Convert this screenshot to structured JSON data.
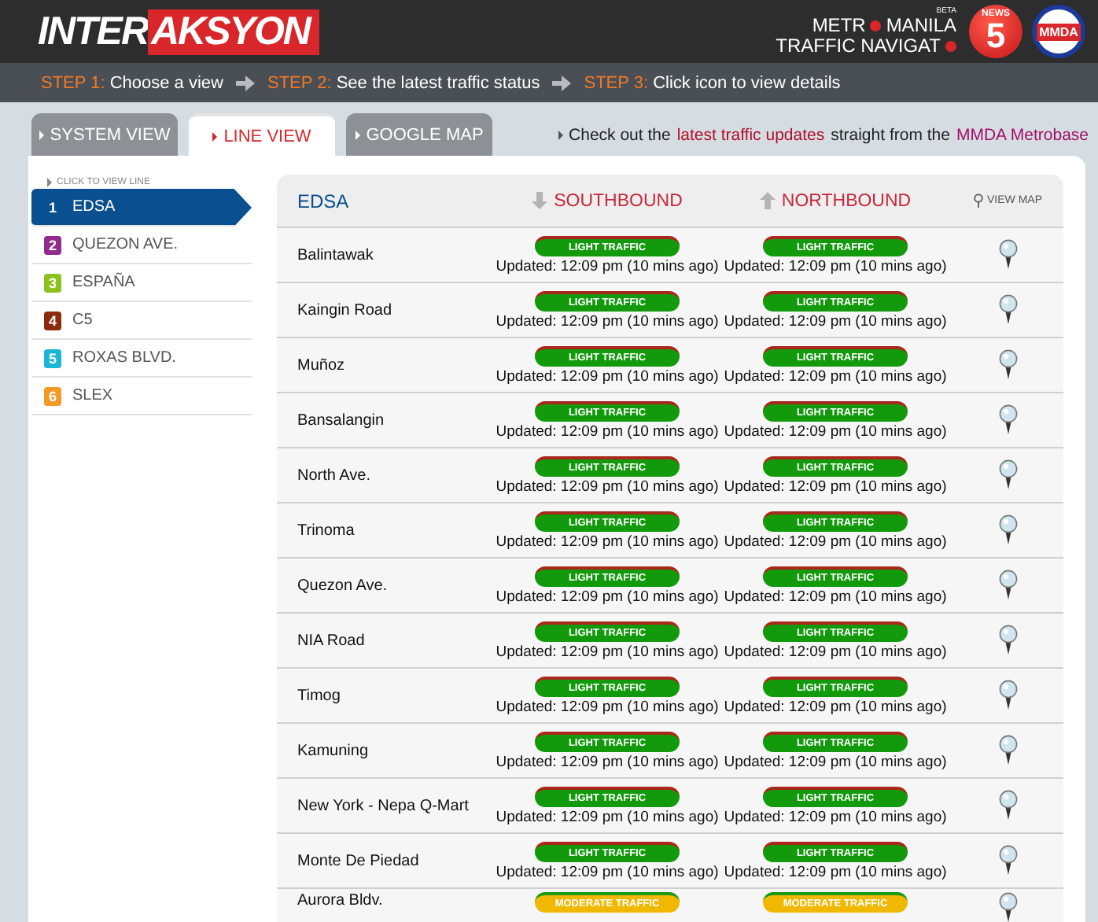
{
  "header": {
    "logo": {
      "part_1": "INTER",
      "part_2": "AKSYON"
    },
    "navigator": {
      "line_1a": "METR",
      "line_1b": "MANILA",
      "badge": "BETA",
      "line_2": "TRAFFIC NAVIGAT"
    },
    "news_logo": {
      "top": "NEWS",
      "number": "5"
    },
    "mmda_logo": {
      "text": "MMDA"
    }
  },
  "steps": [
    {
      "label": "STEP 1:",
      "text": "Choose a view"
    },
    {
      "label": "STEP 2:",
      "text": "See the latest traffic status"
    },
    {
      "label": "STEP 3:",
      "text": "Click icon to view details"
    }
  ],
  "tabs": [
    {
      "label": "SYSTEM VIEW",
      "selected": false
    },
    {
      "label": "LINE VIEW",
      "selected": true
    },
    {
      "label": "GOOGLE MAP",
      "selected": false
    }
  ],
  "notice": {
    "before": "Check out the",
    "link_1": "latest traffic updates",
    "middle": "straight from the",
    "link_2": "MMDA Metrobase"
  },
  "sidebar": {
    "caption": "CLICK TO VIEW LINE",
    "items": [
      {
        "number": "1",
        "label": "EDSA",
        "color": "#0a4f8f",
        "selected": true
      },
      {
        "number": "2",
        "label": "QUEZON AVE.",
        "color": "#932b8c",
        "selected": false
      },
      {
        "number": "3",
        "label": "ESPAÑA",
        "color": "#8cc11f",
        "selected": false
      },
      {
        "number": "4",
        "label": "C5",
        "color": "#8a2b0b",
        "selected": false
      },
      {
        "number": "5",
        "label": "ROXAS BLVD.",
        "color": "#1bb5d6",
        "selected": false
      },
      {
        "number": "6",
        "label": "SLEX",
        "color": "#f39a26",
        "selected": false
      }
    ]
  },
  "table": {
    "columns": {
      "line": "EDSA",
      "south": "SOUTHBOUND",
      "north": "NORTHBOUND",
      "map": "VIEW MAP"
    },
    "rows": [
      {
        "name": "Balintawak",
        "south": {
          "kind": "light",
          "label": "LIGHT TRAFFIC",
          "updated": "Updated: 12:09 pm (10 mins ago)"
        },
        "north": {
          "kind": "light",
          "label": "LIGHT TRAFFIC",
          "updated": "Updated: 12:09 pm (10 mins ago)"
        }
      },
      {
        "name": "Kaingin Road",
        "south": {
          "kind": "light",
          "label": "LIGHT TRAFFIC",
          "updated": "Updated: 12:09 pm (10 mins ago)"
        },
        "north": {
          "kind": "light",
          "label": "LIGHT TRAFFIC",
          "updated": "Updated: 12:09 pm (10 mins ago)"
        }
      },
      {
        "name": "Muñoz",
        "south": {
          "kind": "light",
          "label": "LIGHT TRAFFIC",
          "updated": "Updated: 12:09 pm (10 mins ago)"
        },
        "north": {
          "kind": "light",
          "label": "LIGHT TRAFFIC",
          "updated": "Updated: 12:09 pm (10 mins ago)"
        }
      },
      {
        "name": "Bansalangin",
        "south": {
          "kind": "light",
          "label": "LIGHT TRAFFIC",
          "updated": "Updated: 12:09 pm (10 mins ago)"
        },
        "north": {
          "kind": "light",
          "label": "LIGHT TRAFFIC",
          "updated": "Updated: 12:09 pm (10 mins ago)"
        }
      },
      {
        "name": "North Ave.",
        "south": {
          "kind": "light",
          "label": "LIGHT TRAFFIC",
          "updated": "Updated: 12:09 pm (10 mins ago)"
        },
        "north": {
          "kind": "light",
          "label": "LIGHT TRAFFIC",
          "updated": "Updated: 12:09 pm (10 mins ago)"
        }
      },
      {
        "name": "Trinoma",
        "south": {
          "kind": "light",
          "label": "LIGHT TRAFFIC",
          "updated": "Updated: 12:09 pm (10 mins ago)"
        },
        "north": {
          "kind": "light",
          "label": "LIGHT TRAFFIC",
          "updated": "Updated: 12:09 pm (10 mins ago)"
        }
      },
      {
        "name": "Quezon Ave.",
        "south": {
          "kind": "light",
          "label": "LIGHT TRAFFIC",
          "updated": "Updated: 12:09 pm (10 mins ago)"
        },
        "north": {
          "kind": "light",
          "label": "LIGHT TRAFFIC",
          "updated": "Updated: 12:09 pm (10 mins ago)"
        }
      },
      {
        "name": "NIA Road",
        "south": {
          "kind": "light",
          "label": "LIGHT TRAFFIC",
          "updated": "Updated: 12:09 pm (10 mins ago)"
        },
        "north": {
          "kind": "light",
          "label": "LIGHT TRAFFIC",
          "updated": "Updated: 12:09 pm (10 mins ago)"
        }
      },
      {
        "name": "Timog",
        "south": {
          "kind": "light",
          "label": "LIGHT TRAFFIC",
          "updated": "Updated: 12:09 pm (10 mins ago)"
        },
        "north": {
          "kind": "light",
          "label": "LIGHT TRAFFIC",
          "updated": "Updated: 12:09 pm (10 mins ago)"
        }
      },
      {
        "name": "Kamuning",
        "south": {
          "kind": "light",
          "label": "LIGHT TRAFFIC",
          "updated": "Updated: 12:09 pm (10 mins ago)"
        },
        "north": {
          "kind": "light",
          "label": "LIGHT TRAFFIC",
          "updated": "Updated: 12:09 pm (10 mins ago)"
        }
      },
      {
        "name": "New York - Nepa Q-Mart",
        "south": {
          "kind": "light",
          "label": "LIGHT TRAFFIC",
          "updated": "Updated: 12:09 pm (10 mins ago)"
        },
        "north": {
          "kind": "light",
          "label": "LIGHT TRAFFIC",
          "updated": "Updated: 12:09 pm (10 mins ago)"
        }
      },
      {
        "name": "Monte De Piedad",
        "south": {
          "kind": "light",
          "label": "LIGHT TRAFFIC",
          "updated": "Updated: 12:09 pm (10 mins ago)"
        },
        "north": {
          "kind": "light",
          "label": "LIGHT TRAFFIC",
          "updated": "Updated: 12:09 pm (10 mins ago)"
        }
      },
      {
        "name": "Aurora Bldv.",
        "south": {
          "kind": "moderate",
          "label": "MODERATE TRAFFIC"
        },
        "north": {
          "kind": "moderate",
          "label": "MODERATE TRAFFIC"
        }
      }
    ]
  }
}
